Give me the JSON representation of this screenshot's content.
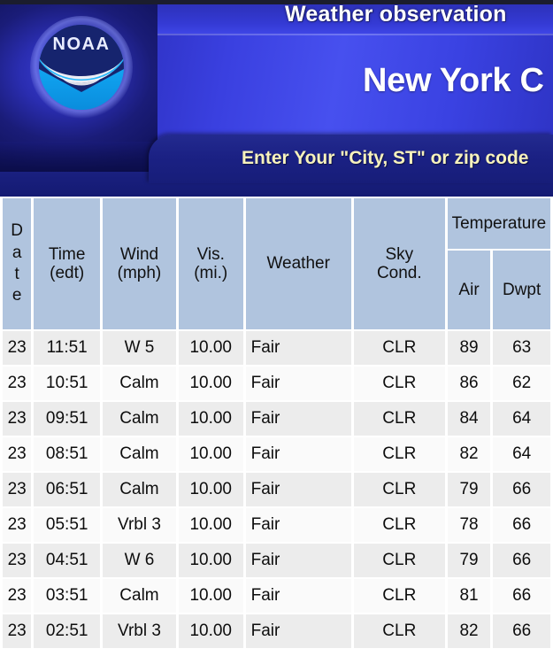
{
  "banner": {
    "title_top": "Weather observation",
    "city": "New York C",
    "search_prompt": "Enter Your \"City, ST\" or zip code",
    "logo_text": "NOAA",
    "colors": {
      "banner_blue": "#3a42e2",
      "banner_navy": "#1b2184",
      "prompt_yellow": "#f7f2bd",
      "header_cell": "#b0c4de",
      "row_odd": "#ececec",
      "row_even": "#fafafa"
    }
  },
  "table": {
    "headers": {
      "date": "Date",
      "date_letters": [
        "D",
        "a",
        "t",
        "e"
      ],
      "time": "Time",
      "time_unit": "(edt)",
      "wind": "Wind",
      "wind_unit": "(mph)",
      "vis": "Vis.",
      "vis_unit": "(mi.)",
      "weather": "Weather",
      "sky_cond_1": "Sky",
      "sky_cond_2": "Cond.",
      "temperature_group": "Temperature",
      "air": "Air",
      "dwpt": "Dwpt"
    },
    "rows": [
      {
        "date": "23",
        "time": "11:51",
        "wind": "W 5",
        "vis": "10.00",
        "weather": "Fair",
        "sky": "CLR",
        "air": "89",
        "dwpt": "63"
      },
      {
        "date": "23",
        "time": "10:51",
        "wind": "Calm",
        "vis": "10.00",
        "weather": "Fair",
        "sky": "CLR",
        "air": "86",
        "dwpt": "62"
      },
      {
        "date": "23",
        "time": "09:51",
        "wind": "Calm",
        "vis": "10.00",
        "weather": "Fair",
        "sky": "CLR",
        "air": "84",
        "dwpt": "64"
      },
      {
        "date": "23",
        "time": "08:51",
        "wind": "Calm",
        "vis": "10.00",
        "weather": "Fair",
        "sky": "CLR",
        "air": "82",
        "dwpt": "64"
      },
      {
        "date": "23",
        "time": "06:51",
        "wind": "Calm",
        "vis": "10.00",
        "weather": "Fair",
        "sky": "CLR",
        "air": "79",
        "dwpt": "66"
      },
      {
        "date": "23",
        "time": "05:51",
        "wind": "Vrbl 3",
        "vis": "10.00",
        "weather": "Fair",
        "sky": "CLR",
        "air": "78",
        "dwpt": "66"
      },
      {
        "date": "23",
        "time": "04:51",
        "wind": "W 6",
        "vis": "10.00",
        "weather": "Fair",
        "sky": "CLR",
        "air": "79",
        "dwpt": "66"
      },
      {
        "date": "23",
        "time": "03:51",
        "wind": "Calm",
        "vis": "10.00",
        "weather": "Fair",
        "sky": "CLR",
        "air": "81",
        "dwpt": "66"
      },
      {
        "date": "23",
        "time": "02:51",
        "wind": "Vrbl 3",
        "vis": "10.00",
        "weather": "Fair",
        "sky": "CLR",
        "air": "82",
        "dwpt": "66"
      }
    ]
  }
}
